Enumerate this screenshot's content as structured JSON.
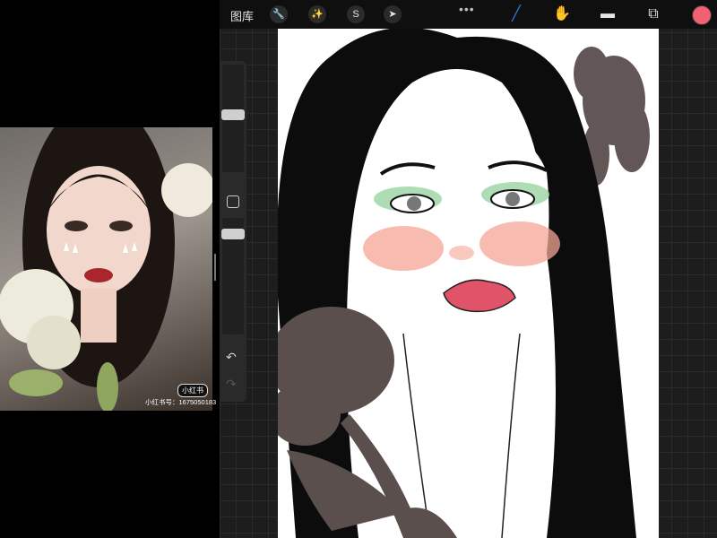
{
  "toolbar": {
    "gallery_label": "图库",
    "more_label": "•••",
    "tools_left": [
      "wrench-icon",
      "magic-wand-icon",
      "selection-icon",
      "transform-arrow-icon"
    ],
    "tools_right": [
      "brush-icon",
      "smudge-icon",
      "eraser-icon",
      "layers-icon"
    ],
    "current_color": "#f06273"
  },
  "reference": {
    "badge": "小红书",
    "id_text": "小红书号：1675050183"
  },
  "sidebar": {
    "undo_icon": "↶",
    "redo_icon": "↷"
  },
  "colors": {
    "brush_active": "#2f7de1",
    "lip": "#e05368",
    "blush": "#f5a495",
    "eyeshadow_green": "#9fd6a8",
    "flower_gray": "#5a4f4d"
  }
}
